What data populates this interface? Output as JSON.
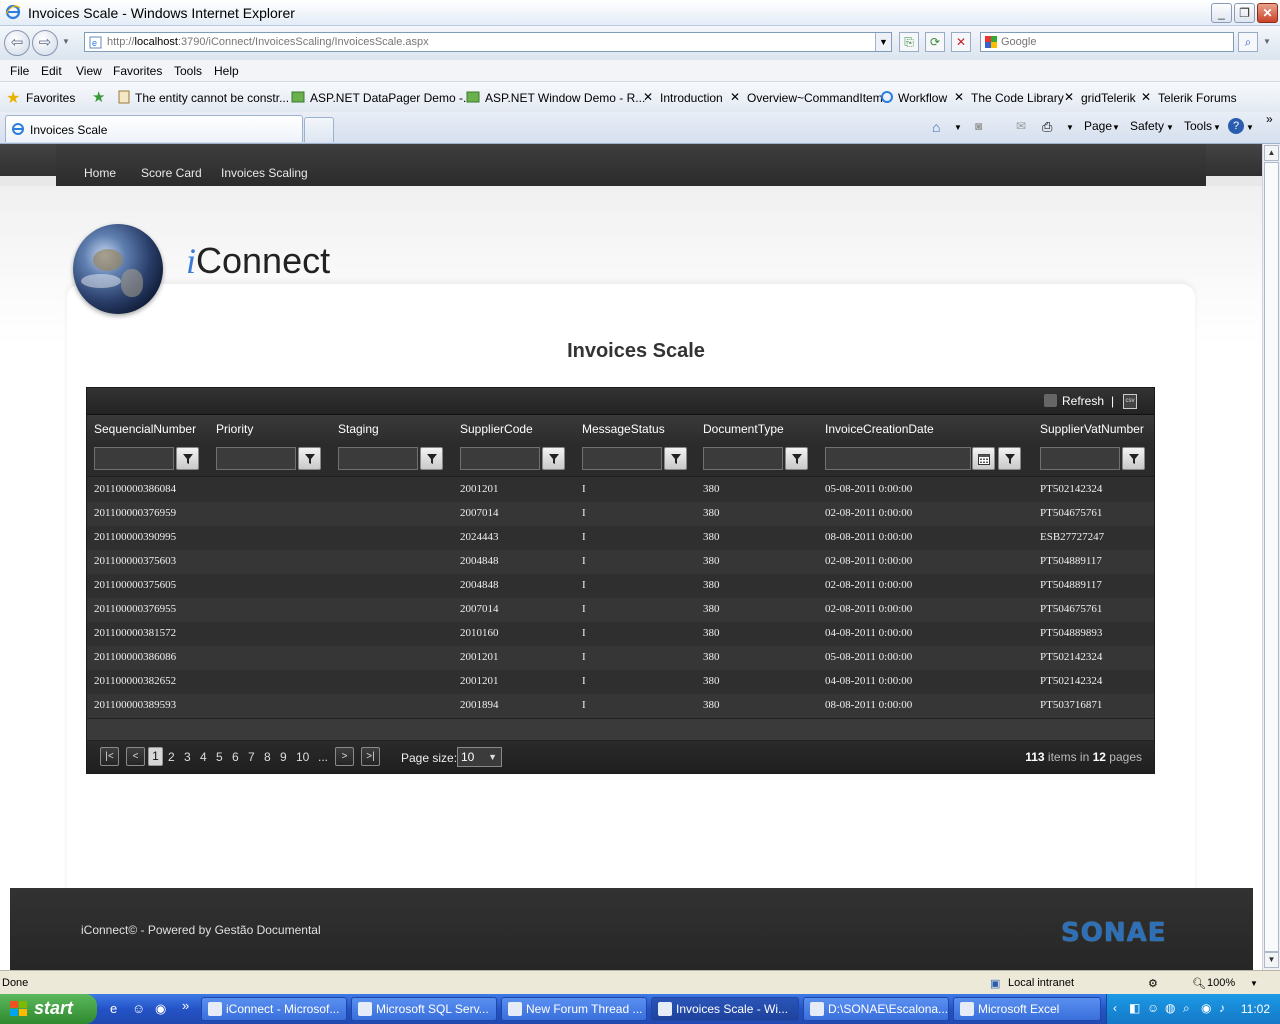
{
  "window": {
    "title": "Invoices Scale - Windows Internet Explorer"
  },
  "address": {
    "url_prefix": "http://",
    "url_host": "localhost",
    "url_rest": ":3790/iConnect/InvoicesScaling/InvoicesScale.aspx"
  },
  "search": {
    "placeholder": "Google"
  },
  "menu": [
    "File",
    "Edit",
    "View",
    "Favorites",
    "Tools",
    "Help"
  ],
  "favorites": {
    "label": "Favorites",
    "items": [
      "The entity cannot be constr...",
      "ASP.NET DataPager Demo -...",
      "ASP.NET Window Demo - R...",
      "Introduction",
      "Overview~CommandItem",
      "Workflow",
      "The Code Library",
      "gridTelerik",
      "Telerik Forums"
    ]
  },
  "tab": {
    "label": "Invoices Scale"
  },
  "commands": {
    "page": "Page",
    "safety": "Safety",
    "tools": "Tools"
  },
  "site": {
    "nav": [
      "Home",
      "Score Card",
      "Invoices Scaling"
    ],
    "brand_i": "i",
    "brand_rest": "Connect",
    "page_title": "Invoices Scale",
    "footer_text": "iConnect© - Powered by Gestão Documental",
    "footer_logo": "SONAE"
  },
  "grid": {
    "toolbar": {
      "refresh": "Refresh",
      "separator": "|",
      "export_icon": "csv"
    },
    "columns": [
      "SequencialNumber",
      "Priority",
      "Staging",
      "SupplierCode",
      "MessageStatus",
      "DocumentType",
      "InvoiceCreationDate",
      "SupplierVatNumber"
    ],
    "rows": [
      [
        "201100000386084",
        "",
        "",
        "2001201",
        "I",
        "380",
        "05-08-2011 0:00:00",
        "PT502142324"
      ],
      [
        "201100000376959",
        "",
        "",
        "2007014",
        "I",
        "380",
        "02-08-2011 0:00:00",
        "PT504675761"
      ],
      [
        "201100000390995",
        "",
        "",
        "2024443",
        "I",
        "380",
        "08-08-2011 0:00:00",
        "ESB27727247"
      ],
      [
        "201100000375603",
        "",
        "",
        "2004848",
        "I",
        "380",
        "02-08-2011 0:00:00",
        "PT504889117"
      ],
      [
        "201100000375605",
        "",
        "",
        "2004848",
        "I",
        "380",
        "02-08-2011 0:00:00",
        "PT504889117"
      ],
      [
        "201100000376955",
        "",
        "",
        "2007014",
        "I",
        "380",
        "02-08-2011 0:00:00",
        "PT504675761"
      ],
      [
        "201100000381572",
        "",
        "",
        "2010160",
        "I",
        "380",
        "04-08-2011 0:00:00",
        "PT504889893"
      ],
      [
        "201100000386086",
        "",
        "",
        "2001201",
        "I",
        "380",
        "05-08-2011 0:00:00",
        "PT502142324"
      ],
      [
        "201100000382652",
        "",
        "",
        "2001201",
        "I",
        "380",
        "04-08-2011 0:00:00",
        "PT502142324"
      ],
      [
        "201100000389593",
        "",
        "",
        "2001894",
        "I",
        "380",
        "08-08-2011 0:00:00",
        "PT503716871"
      ]
    ],
    "pager": {
      "pages": [
        "1",
        "2",
        "3",
        "4",
        "5",
        "6",
        "7",
        "8",
        "9",
        "10",
        "..."
      ],
      "current_page": "1",
      "page_size_label": "Page size:",
      "page_size": "10",
      "items_count": "113",
      "items_text": "items in",
      "pages_count": "12",
      "pages_text": "pages"
    }
  },
  "status": {
    "text": "Done",
    "zone": "Local intranet",
    "zoom": "100%"
  },
  "taskbar": {
    "start": "start",
    "buttons": [
      "iConnect - Microsof...",
      "Microsoft SQL Serv...",
      "New Forum Thread ...",
      "Invoices Scale - Wi...",
      "D:\\SONAE\\Escalona...",
      "Microsoft Excel"
    ],
    "clock": "11:02"
  }
}
